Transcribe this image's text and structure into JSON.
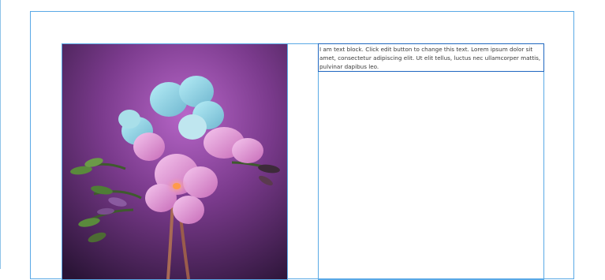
{
  "text_widget": {
    "text": "I am text block. Click edit button to change this text. Lorem ipsum dolor sit amet, consectetur adipiscing elit. Ut elit tellus, luctus nec ullamcorper mattis, pulvinar dapibus leo."
  },
  "image": {
    "icon": "freesia-flower-photo",
    "colors": {
      "background_top": "#b35fc0",
      "background_bottom": "#2a1436",
      "petal_blue": "#8fd3e6",
      "petal_pink": "#e6a4d9",
      "stem": "#4d6b34"
    }
  },
  "colors": {
    "section_border": "#5aa9e6",
    "selected_widget_border": "#1f67c0"
  }
}
